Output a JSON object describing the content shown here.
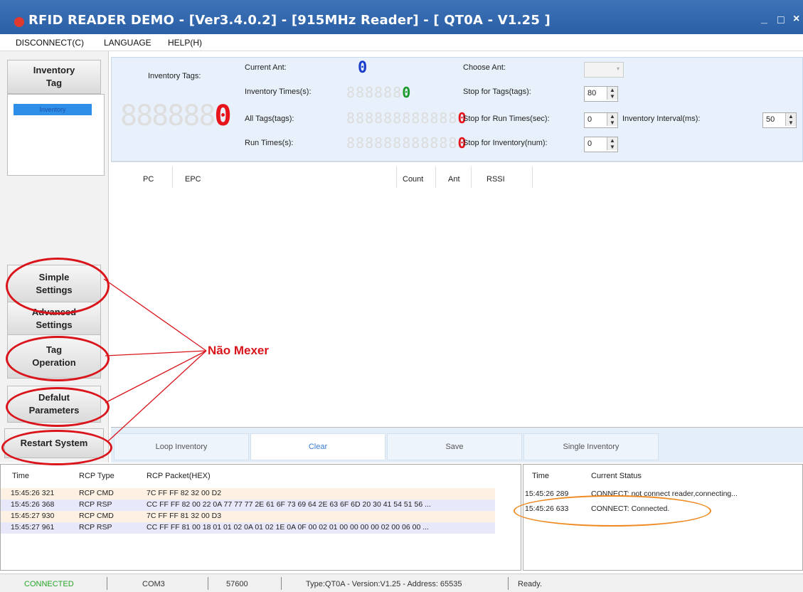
{
  "window": {
    "title": "RFID READER DEMO - [Ver3.4.0.2] - [915MHz Reader] - [ QT0A - V1.25 ]",
    "minimize": "_",
    "maximize": "□",
    "close": "×"
  },
  "menu": [
    "DISCONNECT(C)",
    "LANGUAGE",
    "HELP(H)"
  ],
  "sidebar": {
    "inventory_tag": "Inventory\nTag",
    "inventory_item": "Inventory",
    "simple_settings": "Simple\nSettings",
    "advanced_settings": "Advanced\nSettings",
    "tag_operation": "Tag\nOperation",
    "default_parameters": "Defalut\nParameters",
    "restart_system": "Restart System"
  },
  "annotation": "Não Mexer",
  "inventory_panel": {
    "inventory_tags_label": "Inventory Tags:",
    "inventory_tags_value": "0",
    "current_ant_label": "Current Ant:",
    "current_ant_value": "0",
    "inventory_times_label": "Inventory Times(s):",
    "inventory_times_value": "0",
    "all_tags_label": "All Tags(tags):",
    "all_tags_value": "0",
    "run_times_label": "Run Times(s):",
    "run_times_value": "0",
    "choose_ant_label": "Choose Ant:",
    "stop_tags_label": "Stop for Tags(tags):",
    "stop_tags_value": "80",
    "stop_run_label": "Stop for Run Times(sec):",
    "stop_run_value": "0",
    "stop_inventory_label": "Stop for Inventory(num):",
    "stop_inventory_value": "0",
    "interval_label": "Inventory Interval(ms):",
    "interval_value": "50",
    "segment_placeholder": "888888"
  },
  "tag_table": {
    "columns": [
      "PC",
      "EPC",
      "Count",
      "Ant",
      "RSSI"
    ]
  },
  "actions": [
    "Loop Inventory",
    "Clear",
    "Save",
    "Single Inventory"
  ],
  "packet_log": {
    "columns": [
      "Time",
      "RCP Type",
      "RCP Packet(HEX)"
    ],
    "rows": [
      {
        "time": "15:45:26 321",
        "type": "RCP CMD",
        "packet": "7C FF FF 82 32 00 D2"
      },
      {
        "time": "15:45:26 368",
        "type": "RCP RSP",
        "packet": "CC FF FF 82 00 22 0A 77 77 77 2E 61 6F 73 69 64 2E 63 6F 6D 20 30 41 54 51 56 ..."
      },
      {
        "time": "15:45:27 930",
        "type": "RCP CMD",
        "packet": "7C FF FF 81 32 00 D3"
      },
      {
        "time": "15:45:27 961",
        "type": "RCP RSP",
        "packet": "CC FF FF 81 00 18 01 01 02 0A 01 02 1E 0A 0F 00 02 01 00 00 00 00 02 00 06 00 ..."
      }
    ]
  },
  "status_log": {
    "columns": [
      "Time",
      "Current Status"
    ],
    "rows": [
      {
        "time": "15:45:26 289",
        "status": "CONNECT: not connect reader,connecting..."
      },
      {
        "time": "15:45:26 633",
        "status": "CONNECT: Connected."
      }
    ]
  },
  "statusbar": {
    "connection": "CONNECTED",
    "port": "COM3",
    "baud": "57600",
    "device": "Type:QT0A - Version:V1.25 - Address: 65535",
    "state": "Ready."
  },
  "colors": {
    "title_bg": "#2a5fa6",
    "annotation_red": "#d9141b",
    "status_orange": "#ef8a22",
    "connected_green": "#2aa52a",
    "digit_red": "#e8141b",
    "digit_green": "#1a9a2a",
    "digit_blue": "#1a3ccc"
  }
}
